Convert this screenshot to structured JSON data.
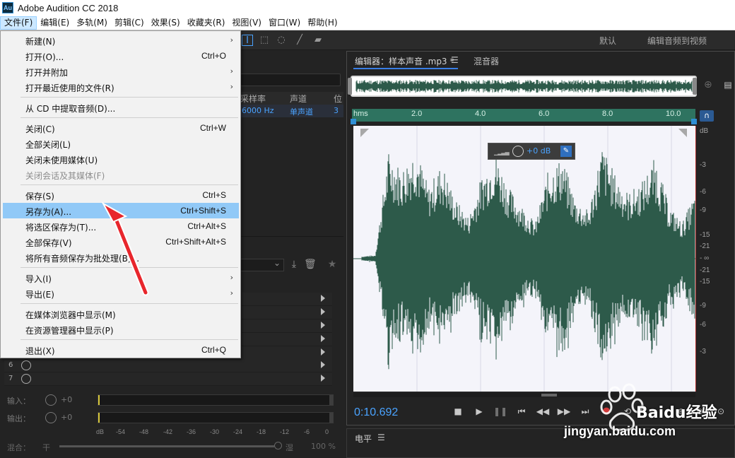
{
  "app": {
    "logo": "Au",
    "title": "Adobe Audition CC 2018"
  },
  "menubar": [
    "文件(F)",
    "编辑(E)",
    "多轨(M)",
    "剪辑(C)",
    "效果(S)",
    "收藏夹(R)",
    "视图(V)",
    "窗口(W)",
    "帮助(H)"
  ],
  "workspaces": {
    "default": "默认",
    "video": "编辑音频到视频"
  },
  "file_menu": [
    {
      "label": "新建(N)",
      "shortcut": "",
      "submenu": true,
      "disabled": false
    },
    {
      "label": "打开(O)...",
      "shortcut": "Ctrl+O",
      "submenu": false,
      "disabled": false
    },
    {
      "label": "打开并附加",
      "shortcut": "",
      "submenu": true,
      "disabled": false
    },
    {
      "label": "打开最近使用的文件(R)",
      "shortcut": "",
      "submenu": true,
      "disabled": false
    },
    {
      "label": "从 CD 中提取音频(D)...",
      "shortcut": "",
      "submenu": false,
      "disabled": false
    },
    {
      "label": "关闭(C)",
      "shortcut": "Ctrl+W",
      "submenu": false,
      "disabled": false
    },
    {
      "label": "全部关闭(L)",
      "shortcut": "",
      "submenu": false,
      "disabled": false
    },
    {
      "label": "关闭未使用媒体(U)",
      "shortcut": "",
      "submenu": false,
      "disabled": false
    },
    {
      "label": "关闭会话及其媒体(F)",
      "shortcut": "",
      "submenu": false,
      "disabled": true
    },
    {
      "label": "保存(S)",
      "shortcut": "Ctrl+S",
      "submenu": false,
      "disabled": false
    },
    {
      "label": "另存为(A)...",
      "shortcut": "Ctrl+Shift+S",
      "submenu": false,
      "disabled": false,
      "highlight": true
    },
    {
      "label": "将选区保存为(T)...",
      "shortcut": "Ctrl+Alt+S",
      "submenu": false,
      "disabled": false
    },
    {
      "label": "全部保存(V)",
      "shortcut": "Ctrl+Shift+Alt+S",
      "submenu": false,
      "disabled": false
    },
    {
      "label": "将所有音频保存为批处理(B)...",
      "shortcut": "",
      "submenu": false,
      "disabled": false
    },
    {
      "label": "导入(I)",
      "shortcut": "",
      "submenu": true,
      "disabled": false
    },
    {
      "label": "导出(E)",
      "shortcut": "",
      "submenu": true,
      "disabled": false
    },
    {
      "label": "在媒体浏览器中显示(M)",
      "shortcut": "",
      "submenu": false,
      "disabled": false
    },
    {
      "label": "在资源管理器中显示(P)",
      "shortcut": "",
      "submenu": false,
      "disabled": false
    },
    {
      "label": "退出(X)",
      "shortcut": "Ctrl+Q",
      "submenu": false,
      "disabled": false
    }
  ],
  "files_panel": {
    "headers": {
      "sample_rate": "采样率",
      "channels": "声道",
      "bit": "位"
    },
    "row": {
      "sample_rate": "6000 Hz",
      "channels": "单声道",
      "bit": "3"
    }
  },
  "effects_rack": {
    "slots": [
      {
        "num": "6"
      },
      {
        "num": "7"
      }
    ],
    "input": {
      "label": "输入：",
      "value": "+0"
    },
    "output": {
      "label": "输出：",
      "value": "+0"
    },
    "scale": [
      "dB",
      "-54",
      "-48",
      "-42",
      "-36",
      "-30",
      "-24",
      "-18",
      "-12",
      "-6",
      "0"
    ],
    "mix": {
      "label": "混合：",
      "dry": "干",
      "wet": "湿",
      "percent": "100 %"
    }
  },
  "editor": {
    "tab_label": "编辑器：样本声音 .mp3 *",
    "tab_mixer": "混音器",
    "timeline": [
      "hms",
      "2.0",
      "4.0",
      "6.0",
      "8.0",
      "10.0"
    ],
    "hud_value": "+0 dB",
    "db_scale": [
      "dB",
      "-3",
      "-6",
      "-9",
      "-15",
      "-21",
      "- ∞",
      "-21",
      "-15",
      "-9",
      "-6",
      "-3"
    ],
    "time_readout": "0:10.692"
  },
  "levels_panel": {
    "title": "电平"
  },
  "watermark": {
    "text": "Baidu经验",
    "url": "jingyan.baidu.com"
  },
  "colors": {
    "waveform": "#2d5a4a",
    "timeline": "#2e7360",
    "highlight": "#91c9f7",
    "accent_blue": "#4aa3ff",
    "arrow": "#e8262c"
  }
}
